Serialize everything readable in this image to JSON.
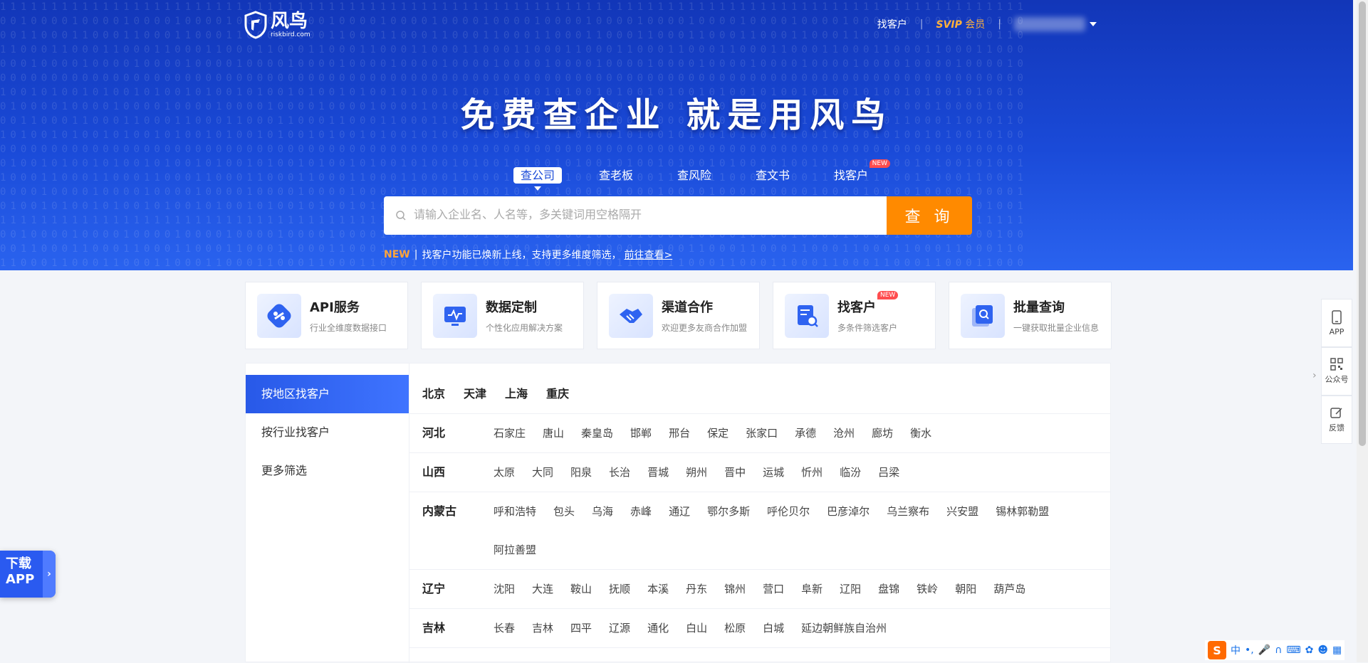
{
  "header": {
    "logo_name": "风鸟",
    "logo_domain": "riskbird.com",
    "nav_find_customer": "找客户",
    "nav_svip": "SVIP",
    "nav_member": "会员"
  },
  "hero": {
    "slogan": "免费查企业 就是用风鸟",
    "tabs": [
      {
        "label": "查公司"
      },
      {
        "label": "查老板"
      },
      {
        "label": "查风险"
      },
      {
        "label": "查文书"
      },
      {
        "label": "找客户",
        "badge": "NEW"
      }
    ],
    "search_placeholder": "请输入企业名、人名等，多关键词用空格隔开",
    "search_button": "查 询",
    "notice_tag": "NEW",
    "notice_text": "找客户功能已焕新上线，支持更多维度筛选，",
    "notice_link": "前往查看>"
  },
  "cards": [
    {
      "title": "API服务",
      "sub": "行业全维度数据接口",
      "icon": "plug-icon"
    },
    {
      "title": "数据定制",
      "sub": "个性化应用解决方案",
      "icon": "monitor-chart-icon"
    },
    {
      "title": "渠道合作",
      "sub": "欢迎更多友商合作加盟",
      "icon": "handshake-icon"
    },
    {
      "title": "找客户",
      "sub": "多条件筛选客户",
      "icon": "document-search-icon",
      "badge": "NEW"
    },
    {
      "title": "批量查询",
      "sub": "一键获取批量企业信息",
      "icon": "batch-search-icon"
    }
  ],
  "sidenav": [
    {
      "label": "按地区找客户"
    },
    {
      "label": "按行业找客户"
    },
    {
      "label": "更多筛选"
    }
  ],
  "municipalities": [
    "北京",
    "天津",
    "上海",
    "重庆"
  ],
  "provinces": [
    {
      "name": "河北",
      "cities": [
        "石家庄",
        "唐山",
        "秦皇岛",
        "邯郸",
        "邢台",
        "保定",
        "张家口",
        "承德",
        "沧州",
        "廊坊",
        "衡水"
      ]
    },
    {
      "name": "山西",
      "cities": [
        "太原",
        "大同",
        "阳泉",
        "长治",
        "晋城",
        "朔州",
        "晋中",
        "运城",
        "忻州",
        "临汾",
        "吕梁"
      ]
    },
    {
      "name": "内蒙古",
      "cities": [
        "呼和浩特",
        "包头",
        "乌海",
        "赤峰",
        "通辽",
        "鄂尔多斯",
        "呼伦贝尔",
        "巴彦淖尔",
        "乌兰察布",
        "兴安盟",
        "锡林郭勒盟",
        "阿拉善盟"
      ]
    },
    {
      "name": "辽宁",
      "cities": [
        "沈阳",
        "大连",
        "鞍山",
        "抚顺",
        "本溪",
        "丹东",
        "锦州",
        "营口",
        "阜新",
        "辽阳",
        "盘锦",
        "铁岭",
        "朝阳",
        "葫芦岛"
      ]
    },
    {
      "name": "吉林",
      "cities": [
        "长春",
        "吉林",
        "四平",
        "辽源",
        "通化",
        "白山",
        "松原",
        "白城",
        "延边朝鲜族自治州"
      ]
    }
  ],
  "download_app": {
    "line1": "下载",
    "line2": "APP"
  },
  "rightbar": [
    {
      "label": "APP",
      "icon": "phone-icon"
    },
    {
      "label": "公众号",
      "icon": "qrcode-icon"
    },
    {
      "label": "反馈",
      "icon": "edit-icon"
    }
  ],
  "ime": {
    "logo": "S",
    "mode": "中"
  }
}
